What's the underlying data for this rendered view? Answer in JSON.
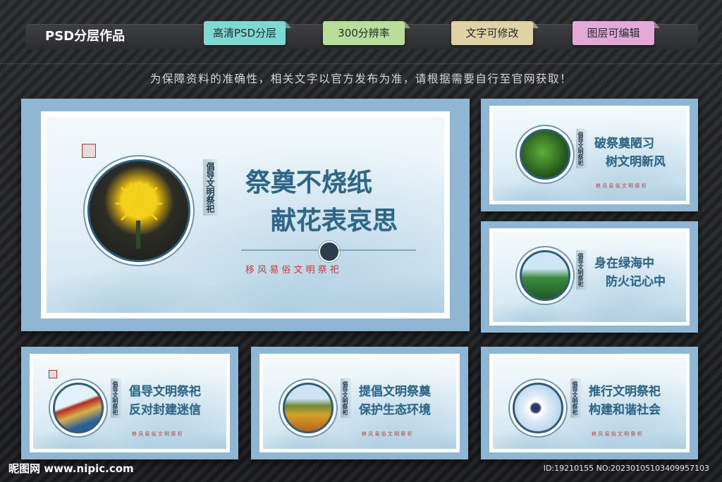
{
  "topbar": {
    "title": "PSD分层作品",
    "tags": [
      {
        "label": "高清PSD分层",
        "color": "#7fd8d2"
      },
      {
        "label": "300分辨率",
        "color": "#b9dd9a"
      },
      {
        "label": "文字可修改",
        "color": "#dfd3a6"
      },
      {
        "label": "图层可编辑",
        "color": "#e3a9d8"
      }
    ]
  },
  "notice": "为保障资料的准确性，相关文字以官方发布为准，请根据需要自行至官网获取！",
  "panels": [
    {
      "vertical": "倡导文明祭祀",
      "line1": "祭奠不烧纸",
      "line2": "献花表哀思",
      "sub": "移 风 易 俗   文 明 祭 祀",
      "image": "yellow-chrysanthemum"
    },
    {
      "vertical": "倡导文明祭祀",
      "line1": "破祭奠陋习",
      "line2": "树文明新风",
      "sub": "移 风 易 俗 文 明 祭 祀",
      "image": "pine-needles"
    },
    {
      "vertical": "倡导文明祭祀",
      "line1": "身在绿海中",
      "line2": "防火记心中",
      "sub": "",
      "image": "green-forest"
    },
    {
      "vertical": "倡导文明祭祀",
      "line1": "倡导文明祭祀",
      "line2": "反对封建迷信",
      "sub": "移 风 易 俗 文 明 祭 祀",
      "image": "red-pavilion-roof"
    },
    {
      "vertical": "倡导文明祭祀",
      "line1": "提倡文明祭奠",
      "line2": "保护生态环境",
      "sub": "移 风 易 俗 文 明 祭 祀",
      "image": "autumn-forest"
    },
    {
      "vertical": "倡导文明祭祀",
      "line1": "推行文明祭祀",
      "line2": "构建和谐社会",
      "sub": "移 风 易 俗 文 明 祭 祀",
      "image": "butterfly-dandelion"
    }
  ],
  "footer": {
    "site": "昵图网 www.nipic.com",
    "id": "ID:19210155 NO:20230105103409957103"
  }
}
